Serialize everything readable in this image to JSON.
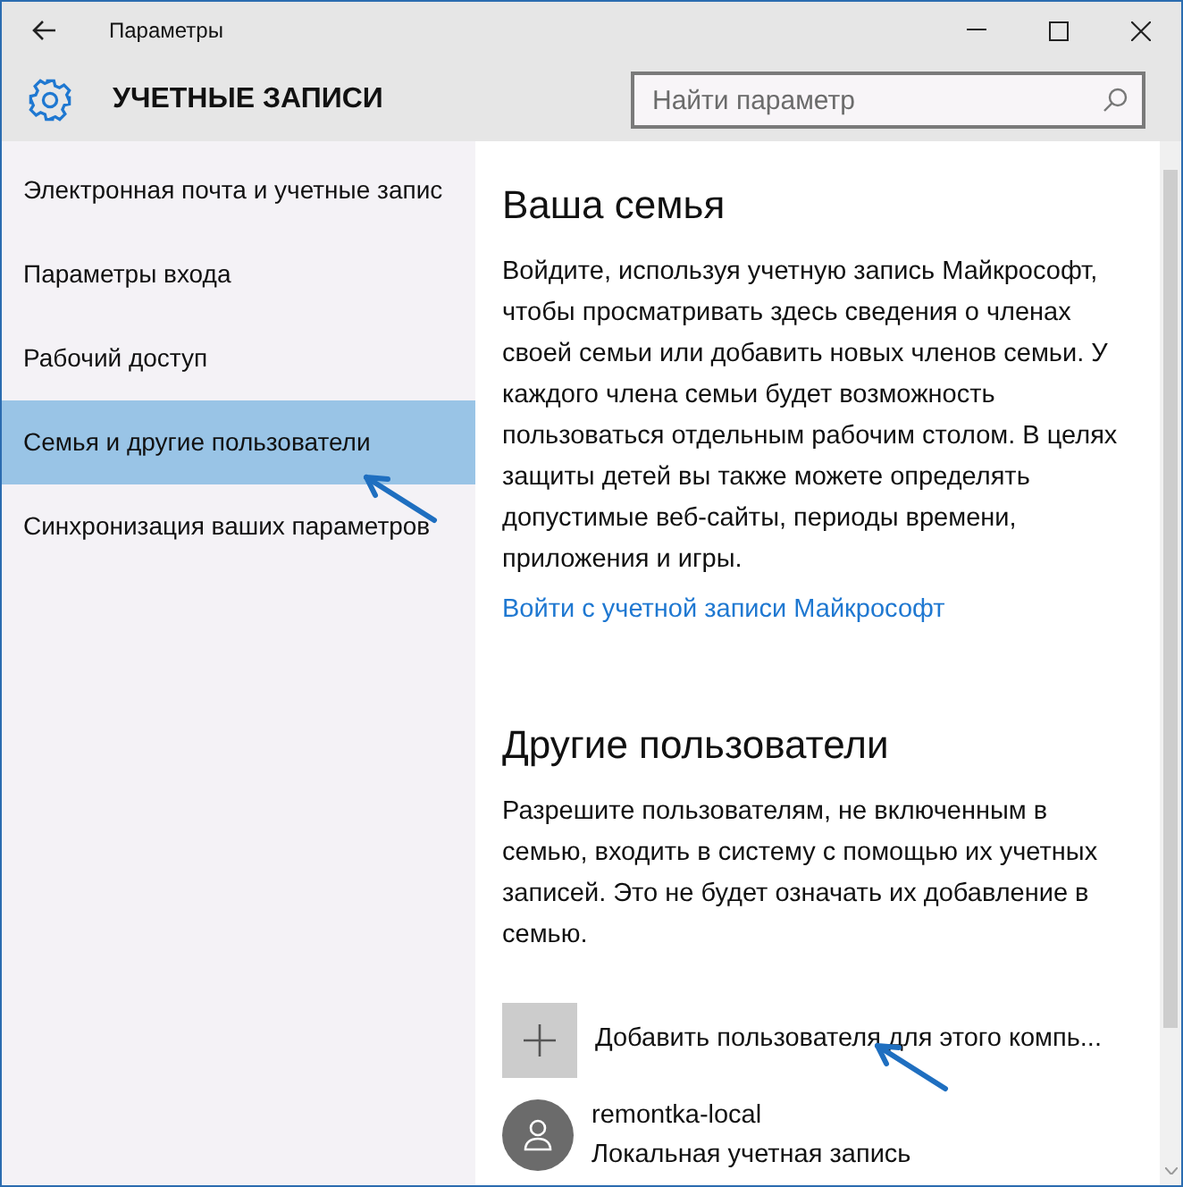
{
  "window": {
    "title": "Параметры"
  },
  "header": {
    "title": "УЧЕТНЫЕ ЗАПИСИ",
    "search": {
      "placeholder": "Найти параметр"
    }
  },
  "sidebar": {
    "items": [
      {
        "label": "Электронная почта и учетные запис",
        "selected": false
      },
      {
        "label": "Параметры входа",
        "selected": false
      },
      {
        "label": "Рабочий доступ",
        "selected": false
      },
      {
        "label": "Семья и другие пользователи",
        "selected": true
      },
      {
        "label": "Синхронизация ваших параметров",
        "selected": false
      }
    ]
  },
  "family": {
    "heading": "Ваша семья",
    "text": "Войдите, используя учетную запись Майкрософт, чтобы просматривать здесь сведения о членах своей семьи или добавить новых членов семьи. У каждого члена семьи будет возможность пользоваться отдельным рабочим столом. В целях защиты детей вы также можете определять допустимые веб-сайты, периоды времени, приложения и игры.",
    "link": "Войти с учетной записи Майкрософт"
  },
  "other_users": {
    "heading": "Другие пользователи",
    "text": "Разрешите пользователям, не включенным в семью, входить в систему с помощью их учетных записей. Это не будет означать их добавление в семью.",
    "add_button": "Добавить пользователя для этого компь...",
    "users": [
      {
        "name": "remontka-local",
        "account_type": "Локальная учетная запись"
      }
    ]
  }
}
